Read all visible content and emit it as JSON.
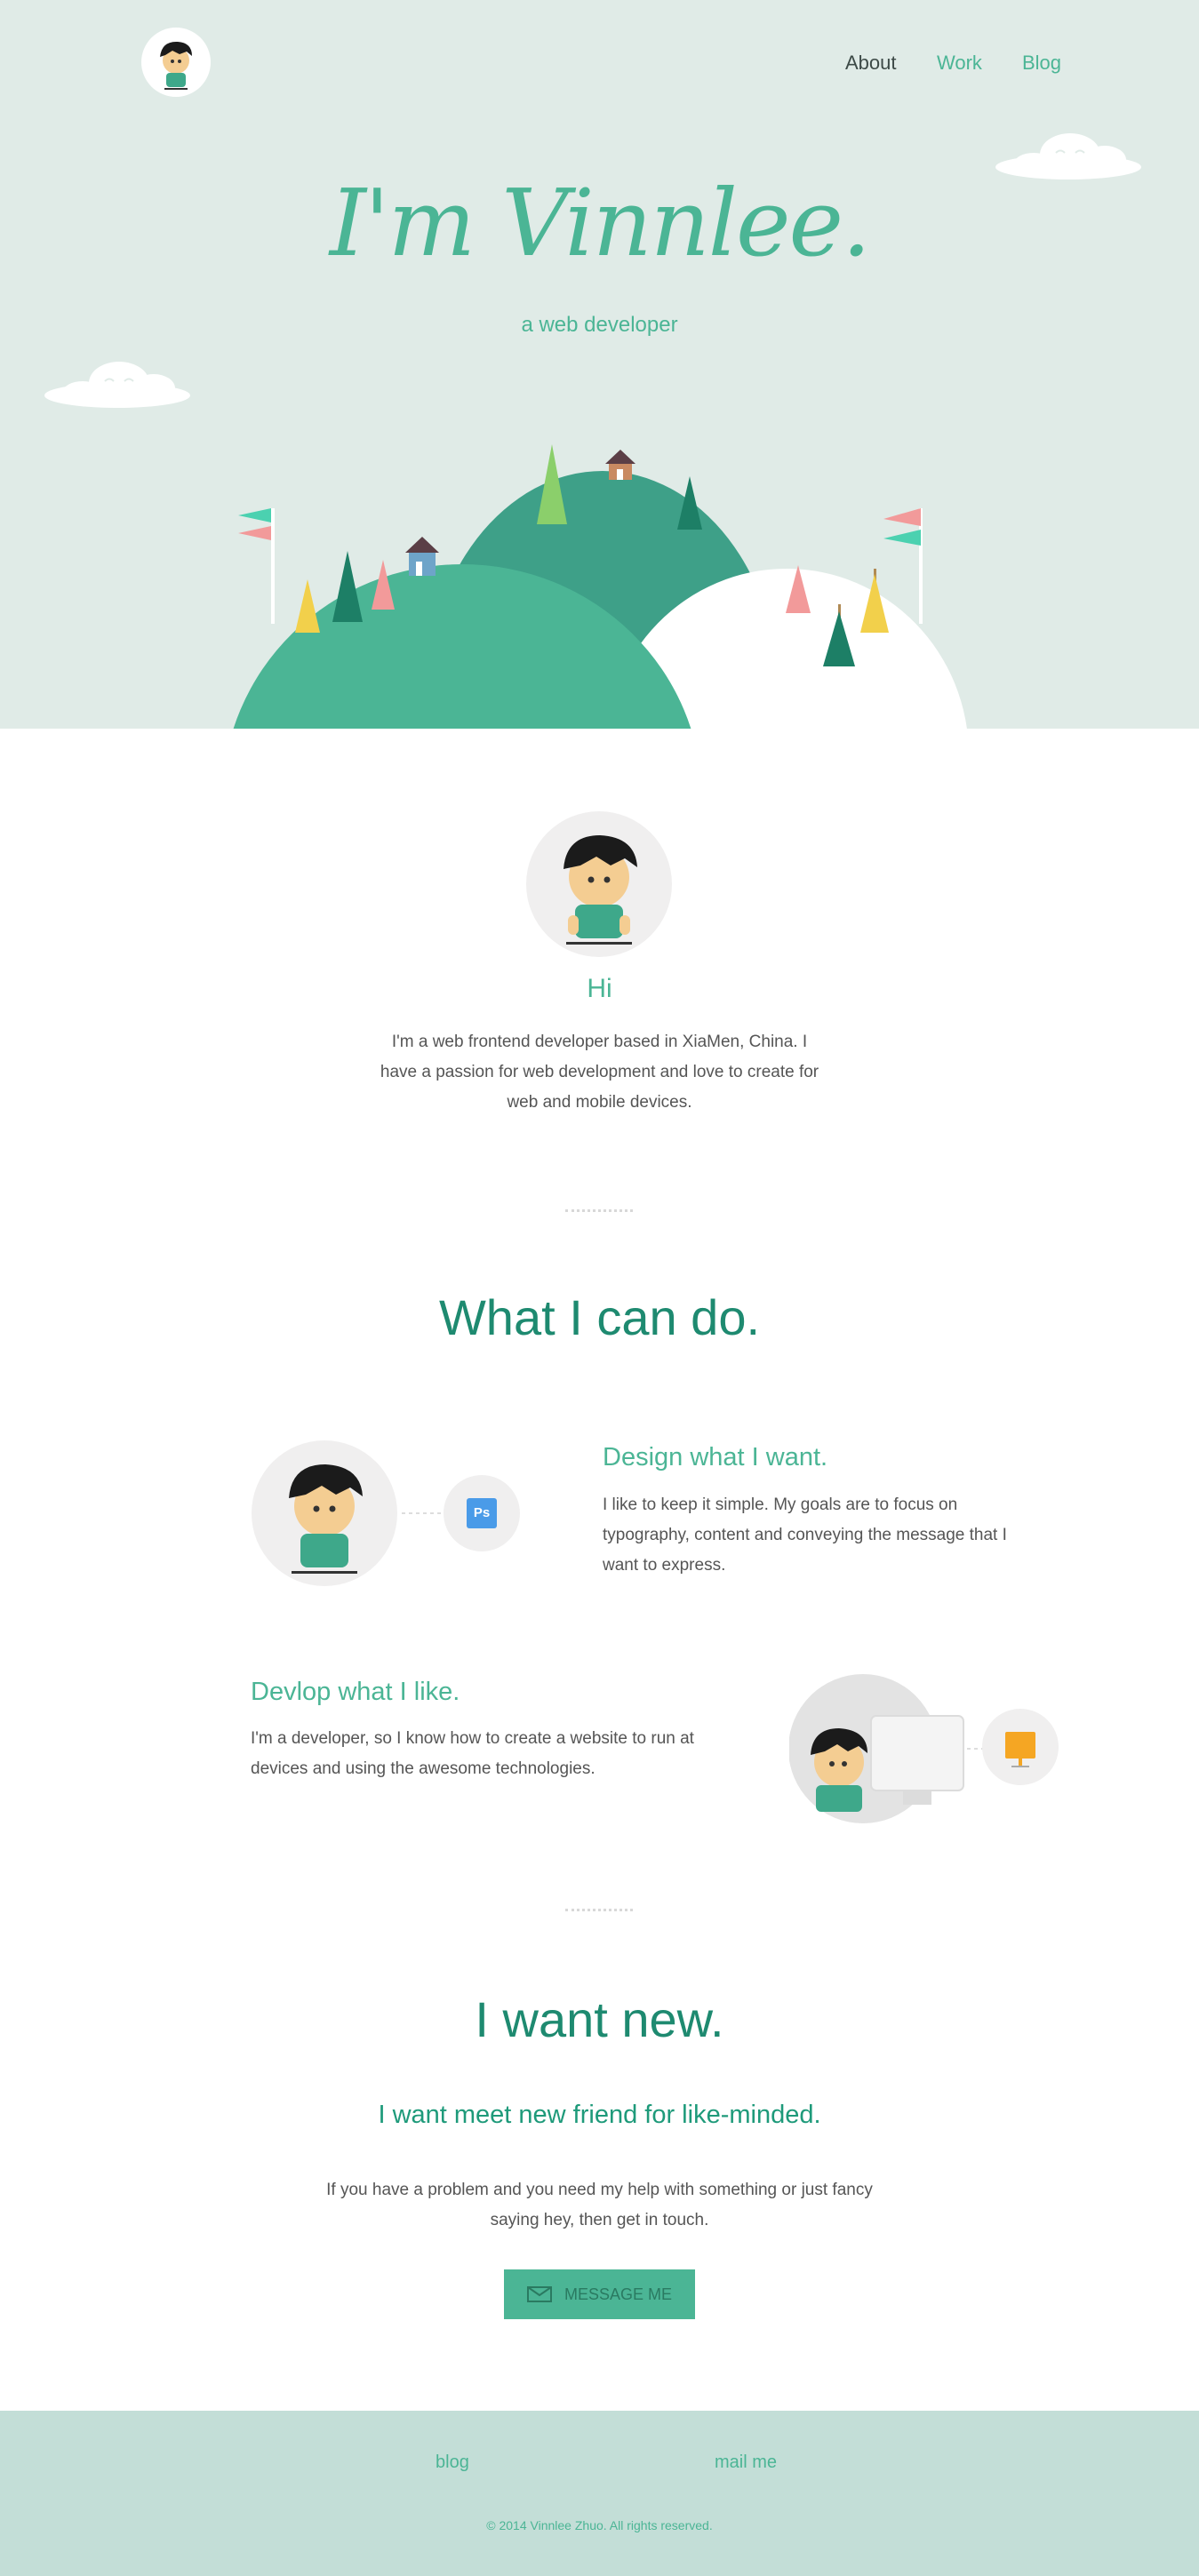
{
  "nav": {
    "items": [
      {
        "label": "About",
        "color": "#3d4a47"
      },
      {
        "label": "Work",
        "color": "#4bb595"
      },
      {
        "label": "Blog",
        "color": "#4bb595"
      }
    ]
  },
  "hero": {
    "title": "I'm Vinnlee.",
    "subtitle": "a web developer"
  },
  "about": {
    "greeting": "Hi",
    "text": "I'm a web frontend developer based in XiaMen, China. I have a passion for web development and love to create for web and mobile devices."
  },
  "skills": {
    "title": "What I can do.",
    "items": [
      {
        "heading": "Design what I want.",
        "text": "I like to keep it simple. My goals are to focus on typography, content and conveying the message that I want to express.",
        "badge": "Ps"
      },
      {
        "heading": "Devlop what I like.",
        "text": "I'm a developer, so I know how to create a website to run at devices and using the awesome technologies."
      }
    ]
  },
  "contact": {
    "title": "I want new.",
    "subtitle": "I want meet new friend for like-minded.",
    "text": "If you have a problem and you need my help with something or just fancy saying hey, then get in touch.",
    "button_label": "MESSAGE ME"
  },
  "footer": {
    "links": [
      "blog",
      "mail me"
    ],
    "copyright": "© 2014 Vinnlee Zhuo. All rights reserved."
  },
  "colors": {
    "accent": "#4bb595",
    "dark_accent": "#1e8a70",
    "hero_bg": "#e0ebe7",
    "footer_bg": "#c3ded7"
  }
}
